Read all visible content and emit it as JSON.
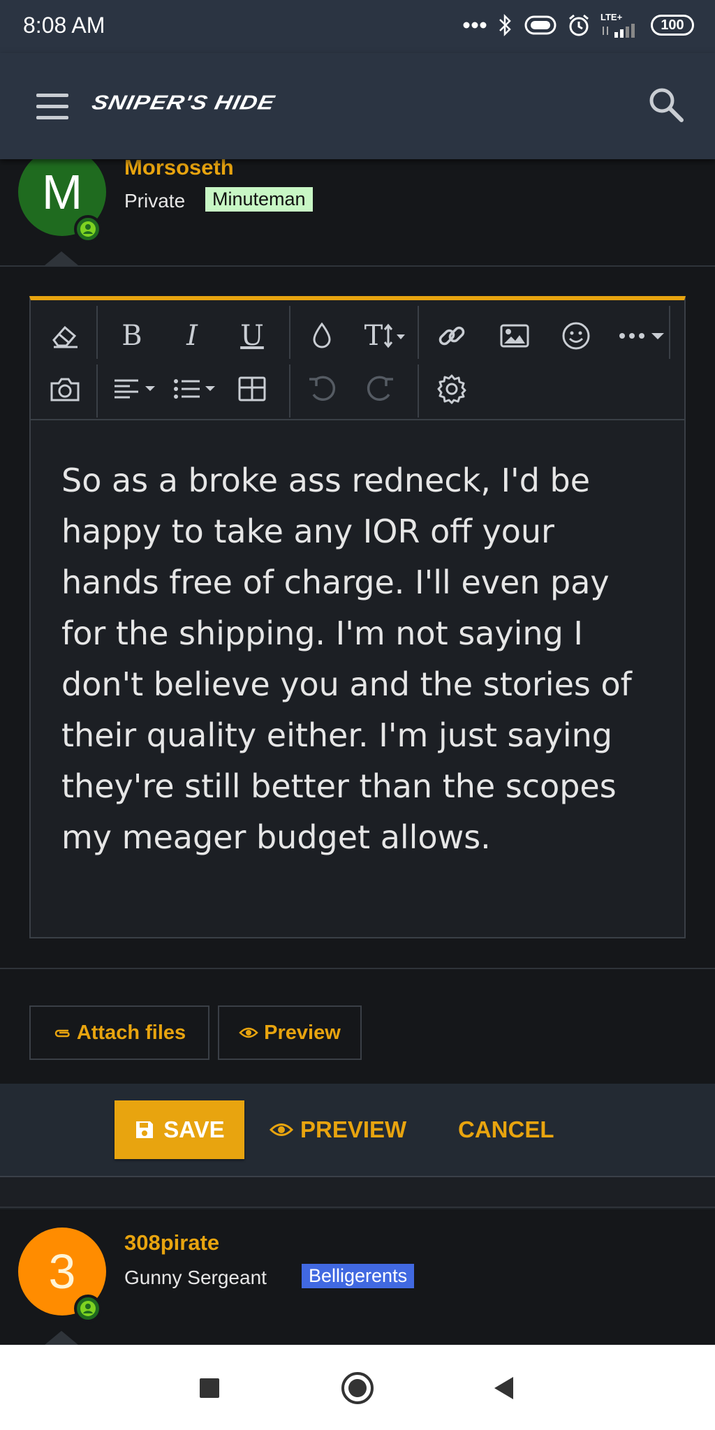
{
  "status_bar": {
    "time": "8:08 AM",
    "network": "LTE+",
    "battery": "100"
  },
  "header": {
    "logo_text": "SNIPER'S HIDE",
    "menu_icon": "hamburger-icon",
    "search_icon": "search-icon"
  },
  "author": {
    "avatar_letter": "M",
    "avatar_color": "#1f6b1f",
    "username": "Morsoseth",
    "rank": "Private",
    "badge": "Minuteman",
    "badge_bg": "#c8f7c5"
  },
  "editor": {
    "toolbar_row1": [
      "eraser-icon",
      "bold",
      "italic",
      "underline",
      "color-drop-icon",
      "text-size-icon",
      "link-icon",
      "image-icon",
      "smiley-icon",
      "more-icon"
    ],
    "toolbar_row2": [
      "camera-icon",
      "align-icon",
      "list-icon",
      "table-icon",
      "undo-icon",
      "redo-icon",
      "gear-icon"
    ],
    "bold_label": "B",
    "italic_label": "I",
    "underline_label": "U",
    "textsize_label": "T",
    "body": "So as a broke ass redneck, I'd be happy to take any IOR off your hands free of charge. I'll even pay for the shipping. I'm not saying I don't believe you and the stories of their quality either. I'm just saying they're still better than the scopes my meager budget allows."
  },
  "attach": {
    "attach_label": "Attach files",
    "preview_label": "Preview"
  },
  "actions": {
    "save_label": "SAVE",
    "preview_label": "PREVIEW",
    "cancel_label": "CANCEL"
  },
  "next_post": {
    "avatar_letter": "3",
    "avatar_color": "#ff8c00",
    "username": "308pirate",
    "rank": "Gunny Sergeant",
    "badge": "Belligerents",
    "badge_bg": "#4169e1"
  },
  "colors": {
    "accent": "#e8a40f",
    "header_bg": "#2b3442",
    "page_bg": "#15171a"
  }
}
